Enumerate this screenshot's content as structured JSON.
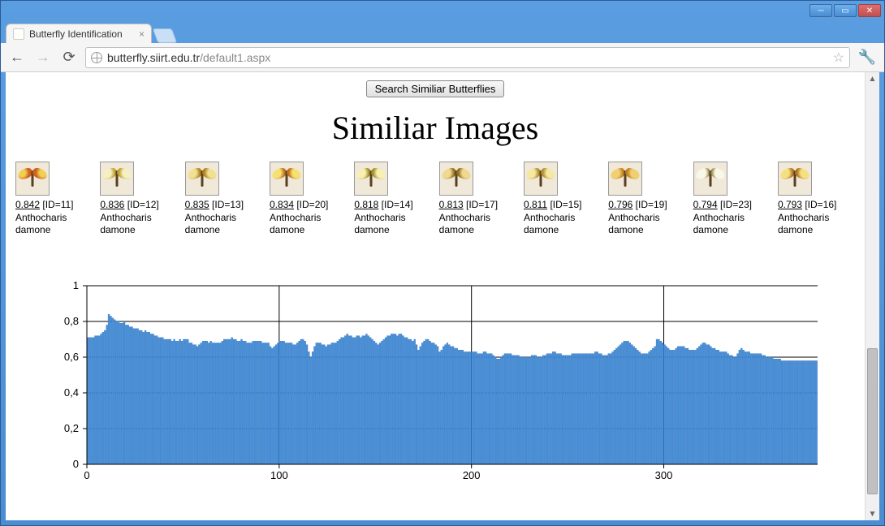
{
  "window": {
    "tab_title": "Butterfly Identification",
    "url_host": "butterfly.siirt.edu.tr",
    "url_path": "/default1.aspx"
  },
  "page": {
    "search_button_label": "Search Similiar Butterflies",
    "heading": "Similiar Images"
  },
  "results": [
    {
      "score": "0.842",
      "id": "11",
      "species": "Anthocharis damone"
    },
    {
      "score": "0.836",
      "id": "12",
      "species": "Anthocharis damone"
    },
    {
      "score": "0.835",
      "id": "13",
      "species": "Anthocharis damone"
    },
    {
      "score": "0.834",
      "id": "20",
      "species": "Anthocharis damone"
    },
    {
      "score": "0.818",
      "id": "14",
      "species": "Anthocharis damone"
    },
    {
      "score": "0.813",
      "id": "17",
      "species": "Anthocharis damone"
    },
    {
      "score": "0.811",
      "id": "15",
      "species": "Anthocharis damone"
    },
    {
      "score": "0.796",
      "id": "19",
      "species": "Anthocharis damone"
    },
    {
      "score": "0.794",
      "id": "23",
      "species": "Anthocharis damone"
    },
    {
      "score": "0.793",
      "id": "16",
      "species": "Anthocharis damone"
    }
  ],
  "chart_data": {
    "type": "bar",
    "title": "",
    "xlabel": "",
    "ylabel": "",
    "xlim": [
      0,
      380
    ],
    "ylim": [
      0,
      1
    ],
    "x_ticks": [
      0,
      100,
      200,
      300
    ],
    "y_ticks": [
      0,
      0.2,
      0.4,
      0.6,
      0.8,
      1
    ],
    "grid_x": [
      100,
      200,
      300
    ],
    "grid_y": [
      0.2,
      0.4,
      0.6,
      0.8,
      1
    ],
    "values": [
      0.71,
      0.71,
      0.71,
      0.71,
      0.72,
      0.72,
      0.72,
      0.73,
      0.74,
      0.75,
      0.78,
      0.84,
      0.83,
      0.82,
      0.81,
      0.8,
      0.8,
      0.79,
      0.79,
      0.8,
      0.78,
      0.78,
      0.77,
      0.77,
      0.76,
      0.76,
      0.76,
      0.75,
      0.75,
      0.74,
      0.75,
      0.74,
      0.74,
      0.73,
      0.73,
      0.72,
      0.72,
      0.71,
      0.71,
      0.71,
      0.7,
      0.7,
      0.7,
      0.7,
      0.69,
      0.7,
      0.69,
      0.69,
      0.7,
      0.69,
      0.7,
      0.7,
      0.7,
      0.68,
      0.68,
      0.67,
      0.67,
      0.66,
      0.67,
      0.68,
      0.69,
      0.69,
      0.69,
      0.68,
      0.69,
      0.68,
      0.68,
      0.68,
      0.68,
      0.68,
      0.69,
      0.7,
      0.7,
      0.7,
      0.7,
      0.71,
      0.7,
      0.7,
      0.69,
      0.69,
      0.7,
      0.69,
      0.69,
      0.68,
      0.68,
      0.68,
      0.69,
      0.69,
      0.69,
      0.69,
      0.69,
      0.68,
      0.68,
      0.68,
      0.68,
      0.66,
      0.65,
      0.66,
      0.67,
      0.68,
      0.69,
      0.69,
      0.69,
      0.68,
      0.68,
      0.68,
      0.68,
      0.67,
      0.67,
      0.68,
      0.69,
      0.7,
      0.7,
      0.69,
      0.67,
      0.63,
      0.6,
      0.63,
      0.66,
      0.68,
      0.68,
      0.68,
      0.67,
      0.67,
      0.66,
      0.67,
      0.67,
      0.68,
      0.68,
      0.68,
      0.69,
      0.7,
      0.71,
      0.71,
      0.72,
      0.73,
      0.72,
      0.72,
      0.71,
      0.71,
      0.72,
      0.72,
      0.71,
      0.72,
      0.72,
      0.73,
      0.72,
      0.71,
      0.7,
      0.69,
      0.68,
      0.67,
      0.68,
      0.69,
      0.7,
      0.71,
      0.72,
      0.72,
      0.73,
      0.73,
      0.73,
      0.72,
      0.73,
      0.73,
      0.72,
      0.71,
      0.71,
      0.7,
      0.7,
      0.69,
      0.7,
      0.67,
      0.64,
      0.66,
      0.68,
      0.69,
      0.7,
      0.7,
      0.69,
      0.68,
      0.68,
      0.67,
      0.66,
      0.63,
      0.64,
      0.66,
      0.67,
      0.68,
      0.67,
      0.66,
      0.66,
      0.65,
      0.65,
      0.64,
      0.64,
      0.64,
      0.63,
      0.63,
      0.63,
      0.63,
      0.63,
      0.63,
      0.63,
      0.62,
      0.62,
      0.62,
      0.63,
      0.63,
      0.62,
      0.62,
      0.62,
      0.61,
      0.6,
      0.59,
      0.59,
      0.6,
      0.61,
      0.62,
      0.62,
      0.62,
      0.62,
      0.61,
      0.61,
      0.61,
      0.61,
      0.6,
      0.6,
      0.6,
      0.6,
      0.6,
      0.6,
      0.61,
      0.61,
      0.61,
      0.6,
      0.6,
      0.6,
      0.61,
      0.61,
      0.62,
      0.62,
      0.62,
      0.63,
      0.63,
      0.62,
      0.62,
      0.62,
      0.61,
      0.61,
      0.61,
      0.61,
      0.61,
      0.62,
      0.62,
      0.62,
      0.62,
      0.62,
      0.62,
      0.62,
      0.62,
      0.62,
      0.62,
      0.62,
      0.62,
      0.63,
      0.63,
      0.62,
      0.62,
      0.61,
      0.61,
      0.61,
      0.62,
      0.62,
      0.63,
      0.64,
      0.65,
      0.66,
      0.67,
      0.68,
      0.69,
      0.69,
      0.69,
      0.68,
      0.67,
      0.66,
      0.65,
      0.64,
      0.63,
      0.62,
      0.62,
      0.62,
      0.62,
      0.63,
      0.64,
      0.65,
      0.66,
      0.7,
      0.7,
      0.69,
      0.68,
      0.67,
      0.66,
      0.65,
      0.64,
      0.64,
      0.64,
      0.65,
      0.66,
      0.66,
      0.66,
      0.66,
      0.65,
      0.65,
      0.64,
      0.64,
      0.64,
      0.64,
      0.65,
      0.66,
      0.67,
      0.68,
      0.68,
      0.67,
      0.67,
      0.66,
      0.65,
      0.65,
      0.64,
      0.64,
      0.63,
      0.63,
      0.63,
      0.63,
      0.62,
      0.61,
      0.61,
      0.6,
      0.6,
      0.62,
      0.64,
      0.65,
      0.64,
      0.63,
      0.63,
      0.63,
      0.62,
      0.62,
      0.62,
      0.62,
      0.62,
      0.62,
      0.61,
      0.61,
      0.6,
      0.6,
      0.6,
      0.6,
      0.59,
      0.59,
      0.59,
      0.59,
      0.58,
      0.58,
      0.58,
      0.58,
      0.58,
      0.58,
      0.58,
      0.58,
      0.58,
      0.58,
      0.58,
      0.58,
      0.58,
      0.58,
      0.58,
      0.58,
      0.58,
      0.58,
      0.58
    ]
  }
}
